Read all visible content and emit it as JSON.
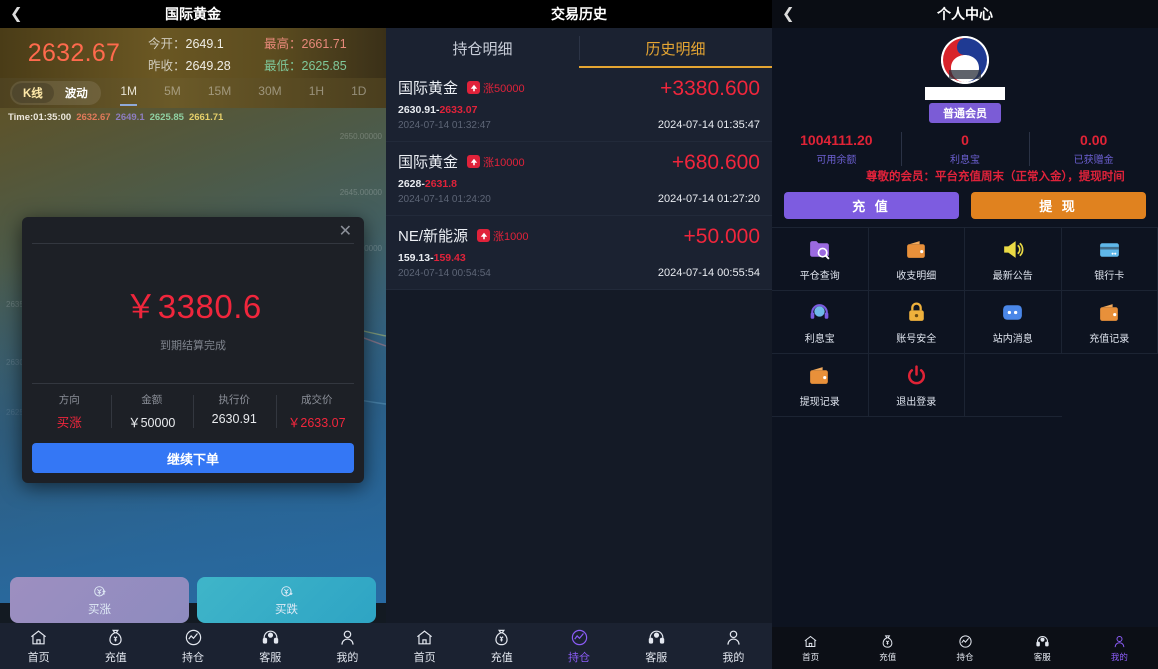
{
  "panel1": {
    "title": "国际黄金",
    "back_icon": "chevron-left-icon",
    "quote": {
      "price": "2632.67",
      "open_label": "今开：",
      "open_value": "2649.1",
      "prevclose_label": "昨收：",
      "prevclose_value": "2649.28",
      "high_label": "最高：",
      "high_value": "2661.71",
      "low_label": "最低：",
      "low_value": "2625.85"
    },
    "chart_tabs": {
      "mode": [
        {
          "label": "K线",
          "active": true
        },
        {
          "label": "波动",
          "active": false
        }
      ],
      "periods": [
        {
          "label": "1M",
          "active": true
        },
        {
          "label": "5M",
          "active": false
        },
        {
          "label": "15M",
          "active": false
        },
        {
          "label": "30M",
          "active": false
        },
        {
          "label": "1H",
          "active": false
        },
        {
          "label": "1D",
          "active": false
        }
      ]
    },
    "timeline": {
      "prefix": "Time:",
      "time": "01:35:00",
      "v1": "2632.67",
      "v2": "2649.1",
      "v3": "2625.85",
      "v4": "2661.71"
    },
    "axis_labels": [
      "2650.00000",
      "2645.00000",
      "2640.00000",
      "2635.00000",
      "2630.00000",
      "2625.00000"
    ],
    "modal": {
      "close_icon": "close-icon",
      "amount": "￥3380.6",
      "subtitle": "到期结算完成",
      "cells": [
        {
          "key": "方向",
          "value": "买涨",
          "red": true
        },
        {
          "key": "金额",
          "value": "￥50000",
          "red": false
        },
        {
          "key": "执行价",
          "value": "2630.91",
          "red": false
        },
        {
          "key": "成交价",
          "value": "￥2633.07",
          "red": true
        }
      ],
      "cta": "继续下单"
    },
    "trade_buttons": [
      {
        "label": "买涨",
        "icon": "yen-up-icon"
      },
      {
        "label": "买跌",
        "icon": "yen-down-icon"
      }
    ]
  },
  "panel2": {
    "title": "交易历史",
    "tabs": [
      {
        "label": "持仓明细",
        "active": false
      },
      {
        "label": "历史明细",
        "active": true
      }
    ],
    "rows": [
      {
        "symbol": "国际黄金",
        "direction": "涨50000",
        "direction_icon": "arrow-up-icon",
        "price_open": "2630.91",
        "price_close": "2633.07",
        "open_time": "2024-07-14 01:32:47",
        "pnl": "+3380.600",
        "close_time": "2024-07-14 01:35:47"
      },
      {
        "symbol": "国际黄金",
        "direction": "涨10000",
        "direction_icon": "arrow-up-icon",
        "price_open": "2628",
        "price_close": "2631.8",
        "open_time": "2024-07-14 01:24:20",
        "pnl": "+680.600",
        "close_time": "2024-07-14 01:27:20"
      },
      {
        "symbol": "NE/新能源",
        "direction": "涨1000",
        "direction_icon": "arrow-up-icon",
        "price_open": "159.13",
        "price_close": "159.43",
        "open_time": "2024-07-14 00:54:54",
        "pnl": "+50.000",
        "close_time": "2024-07-14 00:55:54"
      }
    ]
  },
  "panel3": {
    "title": "个人中心",
    "back_icon": "chevron-left-icon",
    "avatar_icon": "company-logo-icon",
    "username": "",
    "vip_label": "普通会员",
    "balances": [
      {
        "value": "1004111.20",
        "label": "可用余额"
      },
      {
        "value": "0",
        "label": "利息宝"
      },
      {
        "value": "0.00",
        "label": "已获赠金"
      }
    ],
    "notice": "尊敬的会员：平台充值周末（正常入金），提现时间",
    "actions": [
      {
        "label": "充 值",
        "name": "recharge"
      },
      {
        "label": "提 现",
        "name": "withdraw"
      }
    ],
    "grid": [
      {
        "label": "平仓查询",
        "icon": "folder-search-icon"
      },
      {
        "label": "收支明细",
        "icon": "wallet-icon"
      },
      {
        "label": "最新公告",
        "icon": "megaphone-icon"
      },
      {
        "label": "银行卡",
        "icon": "bank-card-icon"
      },
      {
        "label": "利息宝",
        "icon": "headset-icon"
      },
      {
        "label": "账号安全",
        "icon": "lock-icon"
      },
      {
        "label": "站内消息",
        "icon": "chat-icon"
      },
      {
        "label": "充值记录",
        "icon": "wallet-icon"
      },
      {
        "label": "提现记录",
        "icon": "wallet-icon"
      },
      {
        "label": "退出登录",
        "icon": "power-icon"
      }
    ]
  },
  "bottom_nav": [
    {
      "label": "首页",
      "icon": "home-icon"
    },
    {
      "label": "充值",
      "icon": "money-bag-icon"
    },
    {
      "label": "持仓",
      "icon": "chart-circle-icon"
    },
    {
      "label": "客服",
      "icon": "headset-icon"
    },
    {
      "label": "我的",
      "icon": "user-icon"
    }
  ],
  "nav_active": {
    "panel1": -1,
    "panel2": 2,
    "panel3": 4
  },
  "colors": {
    "accent_purple": "#8b5cf6",
    "up_red": "#f0263c",
    "down_green": "#7fc89a",
    "gold": "#e5a532",
    "cta_blue": "#3477f5"
  }
}
